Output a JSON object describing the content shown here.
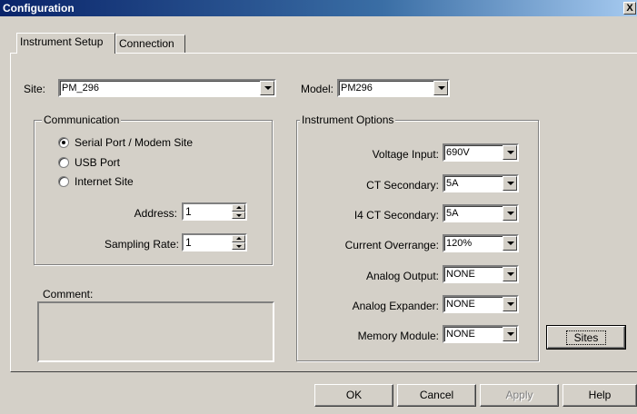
{
  "window": {
    "title": "Configuration",
    "close_label": "X"
  },
  "tabs": [
    {
      "label": "Instrument Setup",
      "active": true
    },
    {
      "label": "Connection",
      "active": false
    }
  ],
  "site": {
    "label": "Site:",
    "value": "PM_296"
  },
  "model": {
    "label": "Model:",
    "value": "PM296"
  },
  "communication": {
    "label": "Communication",
    "options": [
      {
        "label": "Serial Port / Modem Site",
        "selected": true
      },
      {
        "label": "USB Port",
        "selected": false
      },
      {
        "label": "Internet Site",
        "selected": false
      }
    ],
    "address": {
      "label": "Address:",
      "value": "1"
    },
    "sampling_rate": {
      "label": "Sampling Rate:",
      "value": "1"
    }
  },
  "comment": {
    "label": "Comment:",
    "value": ""
  },
  "instrument_options": {
    "label": "Instrument Options",
    "fields": [
      {
        "label": "Voltage Input:",
        "value": "690V"
      },
      {
        "label": "CT Secondary:",
        "value": "5A"
      },
      {
        "label": "I4 CT Secondary:",
        "value": "5A"
      },
      {
        "label": "Current Overrange:",
        "value": "120%"
      },
      {
        "label": "Analog Output:",
        "value": "NONE"
      },
      {
        "label": "Analog Expander:",
        "value": "NONE"
      },
      {
        "label": "Memory Module:",
        "value": "NONE"
      }
    ]
  },
  "buttons": {
    "sites": "Sites",
    "ok": "OK",
    "cancel": "Cancel",
    "apply": "Apply",
    "help": "Help"
  }
}
